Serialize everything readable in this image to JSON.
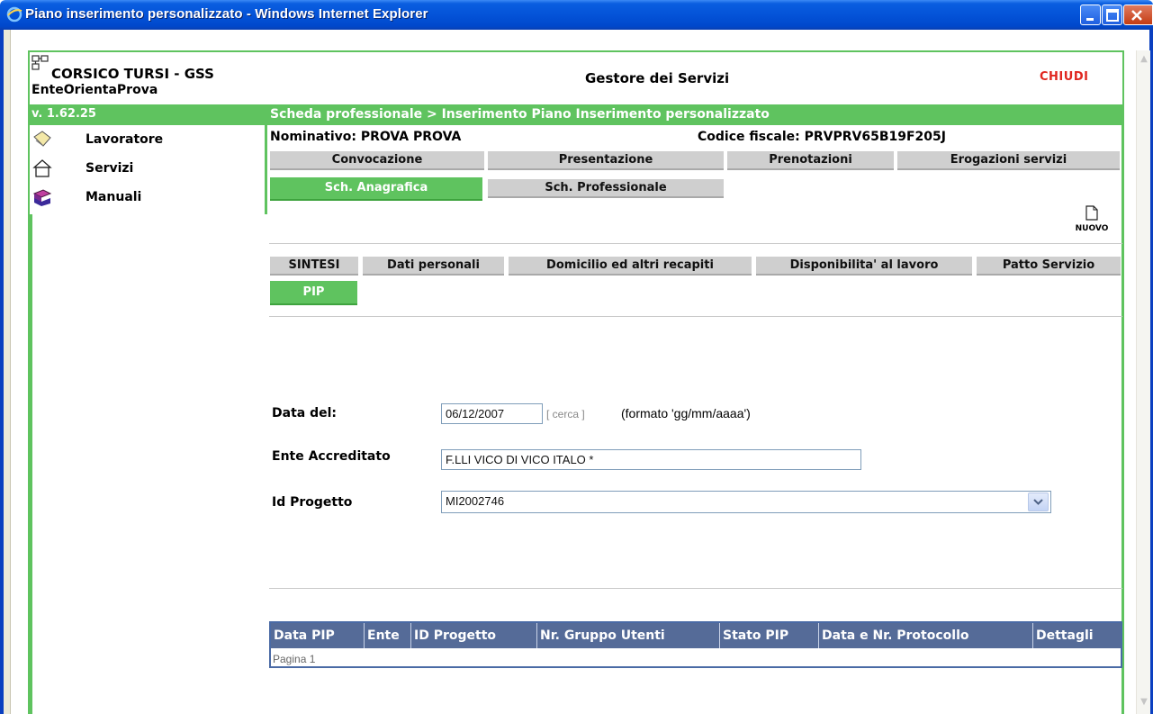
{
  "window": {
    "title": "Piano inserimento personalizzato - Windows Internet Explorer"
  },
  "header": {
    "brand": "CORSICO TURSI - GSS",
    "user": "EnteOrientaProva",
    "app_title": "Gestore dei Servizi",
    "close_label": "CHIUDI"
  },
  "bar": {
    "version": "v. 1.62.25",
    "breadcrumb": "Scheda professionale > Inserimento Piano Inserimento personalizzato"
  },
  "sidebar": {
    "items": [
      {
        "label": "Lavoratore",
        "icon": "lavoratore-icon"
      },
      {
        "label": "Servizi",
        "icon": "servizi-icon"
      },
      {
        "label": "Manuali",
        "icon": "manuali-icon"
      }
    ]
  },
  "person": {
    "name": "Nominativo: PROVA  PROVA",
    "fiscal_code": "Codice fiscale: PRVPRV65B19F205J"
  },
  "top_tabs": [
    "Convocazione",
    "Presentazione",
    "Prenotazioni",
    "Erogazioni servizi"
  ],
  "sheet_tabs": {
    "anagrafica": "Sch. Anagrafica",
    "professionale": "Sch. Professionale"
  },
  "new_button": {
    "label": "NUOVO"
  },
  "sub_tabs": [
    "SINTESI",
    "Dati personali",
    "Domicilio ed altri recapiti",
    "Disponibilita' al lavoro",
    "Patto Servizio",
    "PIP"
  ],
  "form": {
    "date_label": "Data del:",
    "date_value": "06/12/2007",
    "cerca": "[ cerca ]",
    "date_format": "(formato 'gg/mm/aaaa')",
    "ente_label": "Ente Accreditato",
    "ente_value": "F.LLI VICO DI VICO ITALO *",
    "progetto_label": "Id Progetto",
    "progetto_value": "MI2002746"
  },
  "table": {
    "columns": [
      "Data PIP",
      "Ente",
      "ID Progetto",
      "Nr. Gruppo Utenti",
      "Stato PIP",
      "Data e Nr. Protocollo",
      "Dettagli"
    ],
    "pagination": "Pagina 1"
  },
  "colors": {
    "accent_green": "#5fc35f",
    "close_red": "#e0261f",
    "table_header": "#556b98"
  }
}
